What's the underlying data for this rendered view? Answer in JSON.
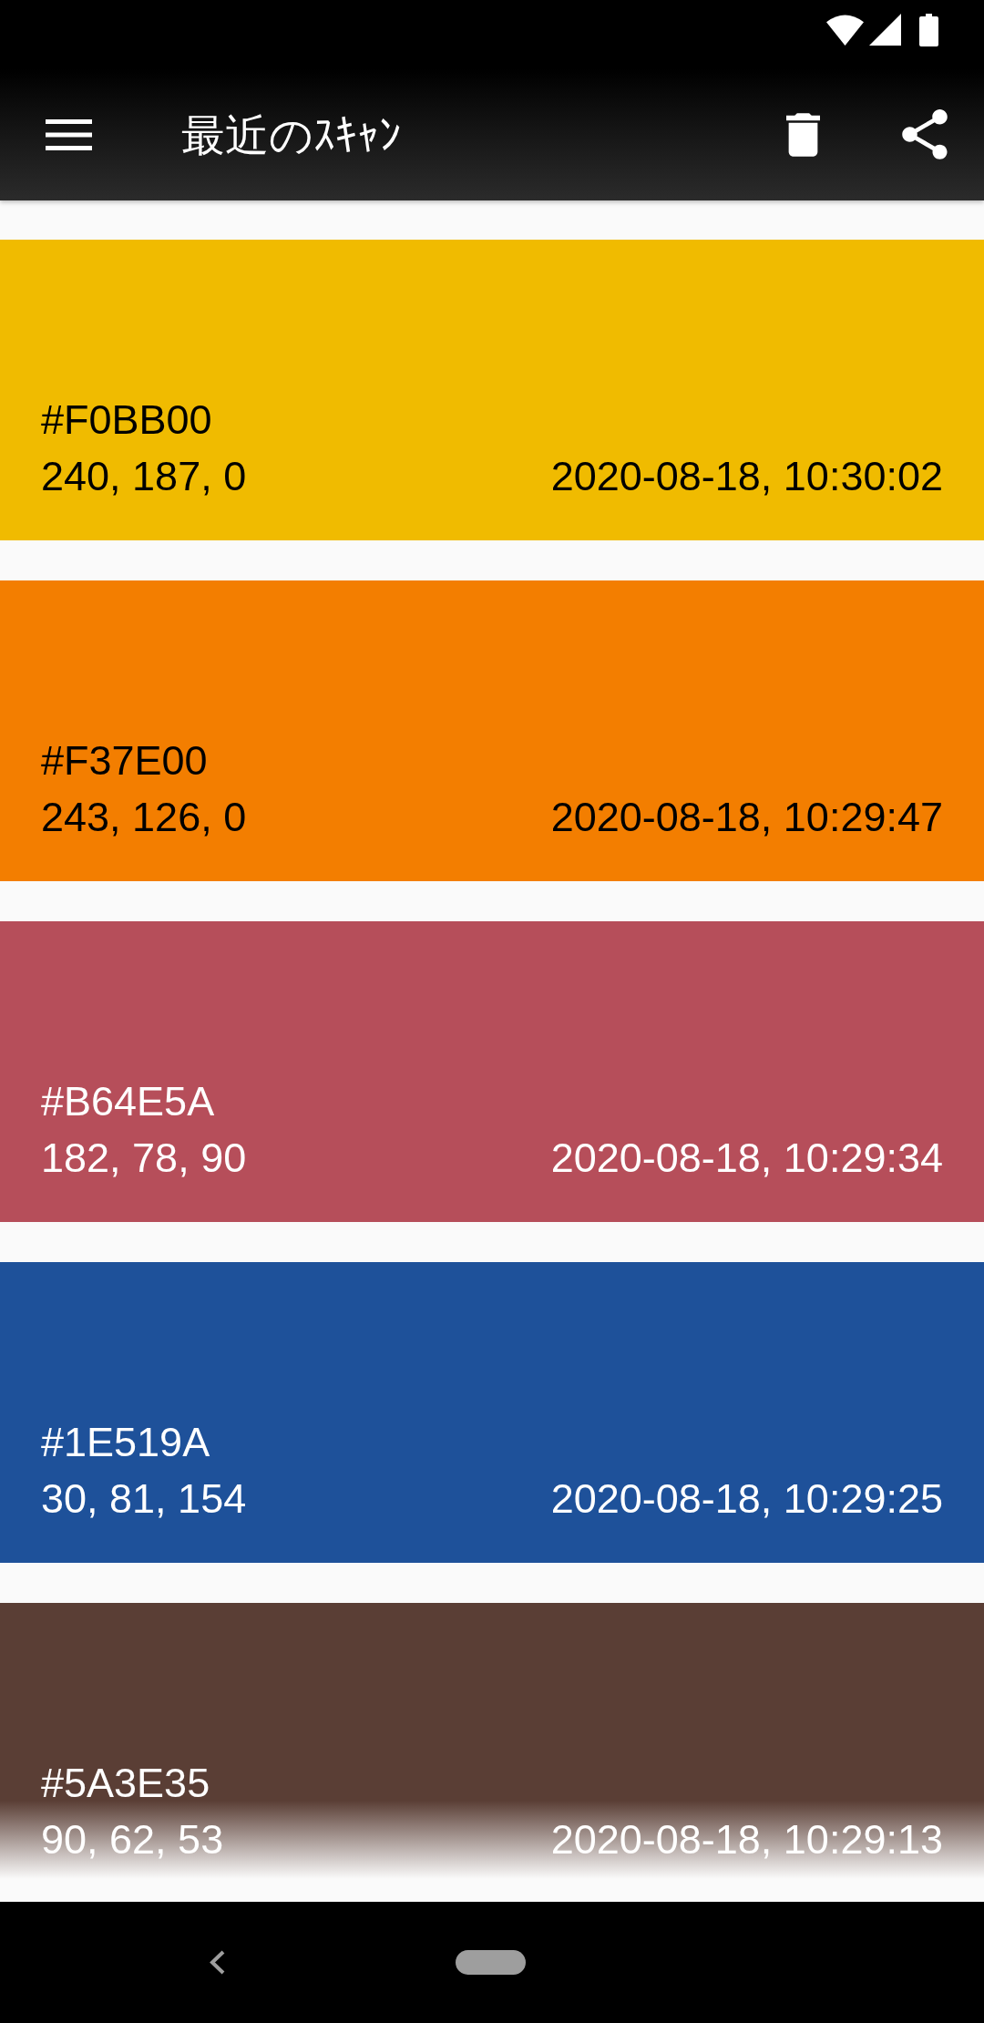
{
  "app_bar": {
    "title": "最近のｽｷｬﾝ"
  },
  "scans": [
    {
      "color": "#f0bb00",
      "hex": "#F0BB00",
      "rgb": "240, 187, 0",
      "timestamp": "2020-08-18, 10:30:02"
    },
    {
      "color": "#f37e00",
      "hex": "#F37E00",
      "rgb": "243, 126, 0",
      "timestamp": "2020-08-18, 10:29:47"
    },
    {
      "color": "#b64e5a",
      "hex": "#B64E5A",
      "rgb": "182, 78, 90",
      "timestamp": "2020-08-18, 10:29:34"
    },
    {
      "color": "#1e519a",
      "hex": "#1E519A",
      "rgb": "30, 81, 154",
      "timestamp": "2020-08-18, 10:29:25"
    },
    {
      "color": "#5a3e35",
      "hex": "#5A3E35",
      "rgb": "90, 62, 53",
      "timestamp": "2020-08-18, 10:29:13"
    }
  ]
}
